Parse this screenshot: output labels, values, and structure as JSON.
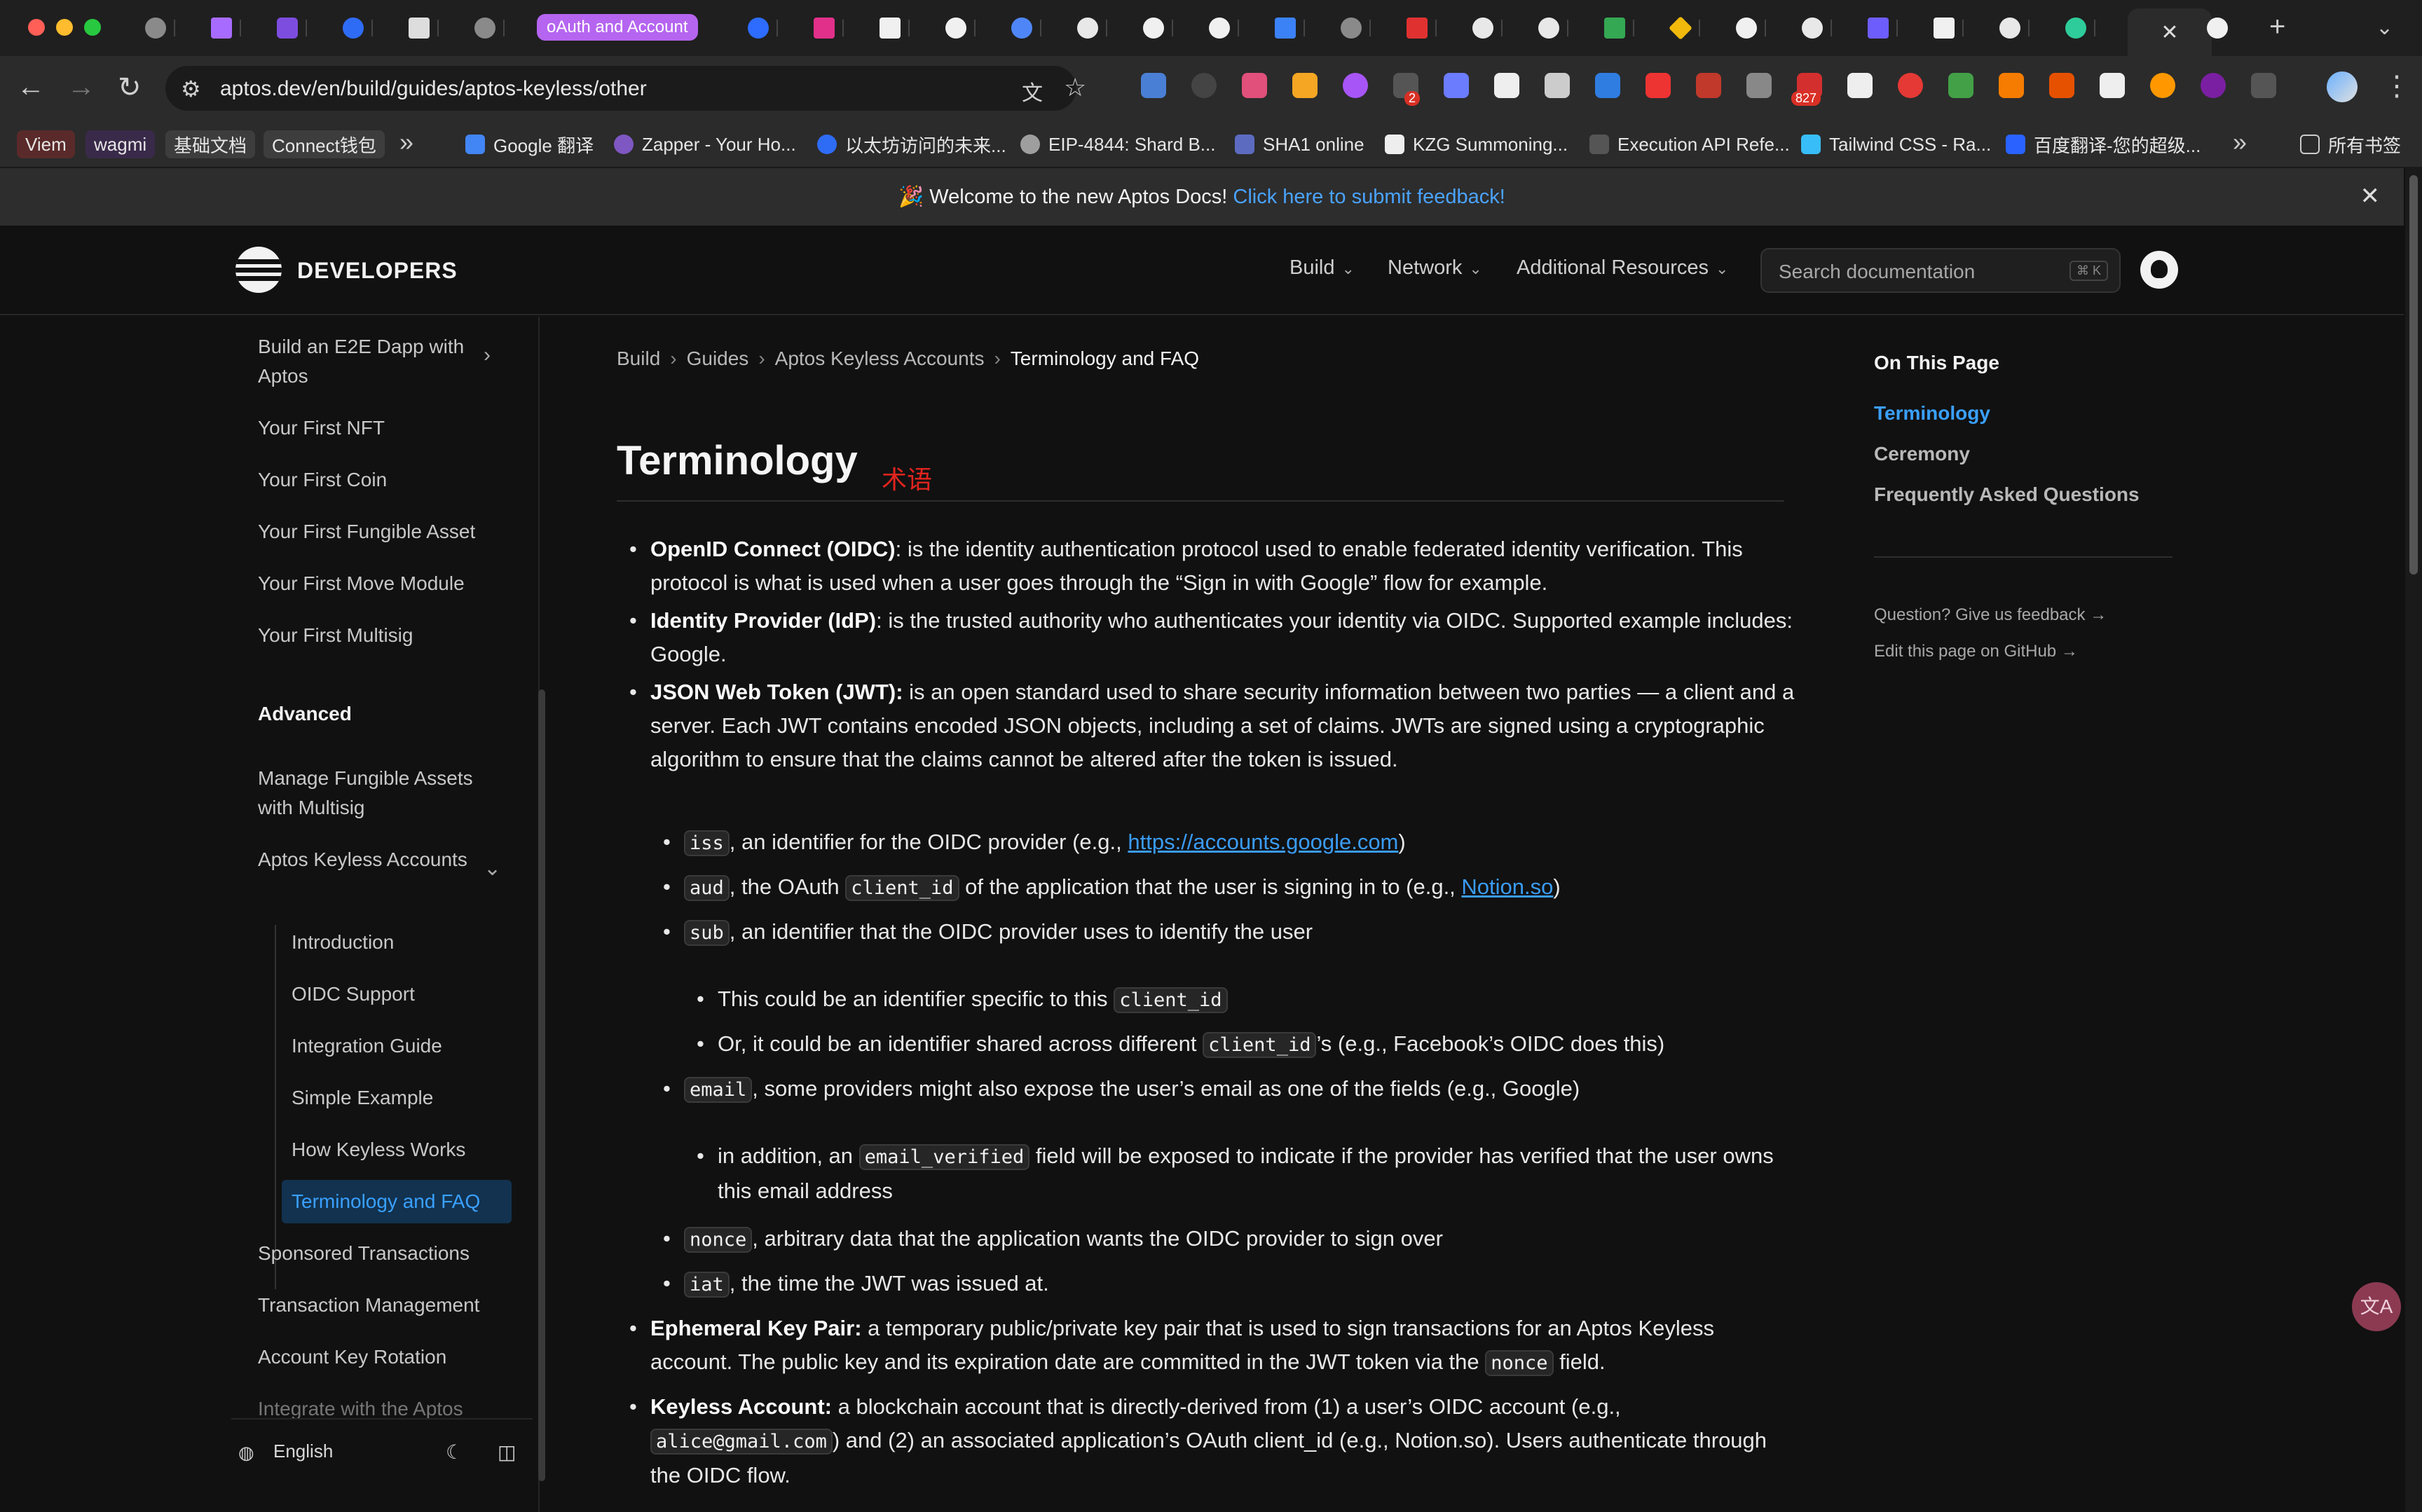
{
  "browser": {
    "active_tab_label": "oAuth and Account",
    "address": "aptos.dev/en/build/guides/aptos-keyless/other",
    "extension_badge": "2",
    "extension_count": "827",
    "bookmarks": [
      {
        "label": "Viem"
      },
      {
        "label": "wagmi"
      },
      {
        "label": "基础文档"
      },
      {
        "label": "Connect钱包"
      },
      {
        "label": "Google 翻译"
      },
      {
        "label": "Zapper - Your Ho..."
      },
      {
        "label": "以太坊访问的未来..."
      },
      {
        "label": "EIP-4844: Shard B..."
      },
      {
        "label": "SHA1 online"
      },
      {
        "label": "KZG Summoning..."
      },
      {
        "label": "Execution API Refe..."
      },
      {
        "label": "Tailwind CSS - Ra..."
      },
      {
        "label": "百度翻译-您的超级..."
      },
      {
        "label": "所有书签"
      }
    ]
  },
  "banner": {
    "text": "🎉 Welcome to the new Aptos Docs!",
    "link": "Click here to submit feedback!"
  },
  "header": {
    "brand": "DEVELOPERS",
    "nav": [
      "Build",
      "Network",
      "Additional Resources"
    ],
    "search_placeholder": "Search documentation",
    "search_shortcut": "⌘ K"
  },
  "sidebar": {
    "items": [
      "Build an E2E Dapp with Aptos",
      "Your First NFT",
      "Your First Coin",
      "Your First Fungible Asset",
      "Your First Move Module",
      "Your First Multisig",
      "Advanced",
      "Manage Fungible Assets with Multisig",
      "Aptos Keyless Accounts",
      "Introduction",
      "OIDC Support",
      "Integration Guide",
      "Simple Example",
      "How Keyless Works",
      "Terminology and FAQ",
      "Sponsored Transactions",
      "Transaction Management",
      "Account Key Rotation",
      "Integrate with the Aptos"
    ],
    "language": "English"
  },
  "breadcrumb": [
    "Build",
    "Guides",
    "Aptos Keyless Accounts",
    "Terminology and FAQ"
  ],
  "page": {
    "title": "Terminology",
    "annotation": "术语"
  },
  "terms": {
    "oidc_term": "OpenID Connect (OIDC)",
    "oidc_desc": ": is the identity authentication protocol used to enable federated identity verification. This protocol is what is used when a user goes through the “Sign in with Google” flow for example.",
    "idp_term": "Identity Provider (IdP)",
    "idp_desc": ": is the trusted authority who authenticates your identity via OIDC. Supported example includes: Google.",
    "jwt_term": "JSON Web Token (JWT):",
    "jwt_desc": " is an open standard used to share security information between two parties — a client and a server. Each JWT contains encoded JSON objects, including a set of claims. JWTs are signed using a cryptographic algorithm to ensure that the claims cannot be altered after the token is issued.",
    "iss_code": "iss",
    "iss_text": ", an identifier for the OIDC provider (e.g., ",
    "iss_link": "https://accounts.google.com",
    "iss_end": ")",
    "aud_code": "aud",
    "aud_text1": ", the OAuth ",
    "aud_code2": "client_id",
    "aud_text2": " of the application that the user is signing in to (e.g., ",
    "aud_link": "Notion.so",
    "aud_end": ")",
    "sub_code": "sub",
    "sub_text": ", an identifier that the OIDC provider uses to identify the user",
    "sub1_text": "This could be an identifier specific to this ",
    "sub1_code": "client_id",
    "sub2_text": "Or, it could be an identifier shared across different ",
    "sub2_code": "client_id",
    "sub2_end": "’s (e.g., Facebook’s OIDC does this)",
    "email_code": "email",
    "email_text": ", some providers might also expose the user’s email as one of the fields (e.g., Google)",
    "ev_text1": "in addition, an ",
    "ev_code": "email_verified",
    "ev_text2": " field will be exposed to indicate if the provider has verified that the user owns this email address",
    "nonce_code": "nonce",
    "nonce_text": ", arbitrary data that the application wants the OIDC provider to sign over",
    "iat_code": "iat",
    "iat_text": ", the time the JWT was issued at.",
    "ekp_term": "Ephemeral Key Pair:",
    "ekp_text1": " a temporary public/private key pair that is used to sign transactions for an Aptos Keyless account. The public key and its expiration date are committed in the JWT token via the ",
    "ekp_code": "nonce",
    "ekp_text2": " field.",
    "ka_term": "Keyless Account:",
    "ka_text1": " a blockchain account that is directly-derived from (1) a user’s OIDC account (e.g., ",
    "ka_code": "alice@gmail.com",
    "ka_text2": ") and (2) an associated application’s OAuth client_id (e.g., Notion.so). Users authenticate through the OIDC flow."
  },
  "toc": {
    "title": "On This Page",
    "items": [
      "Terminology",
      "Ceremony",
      "Frequently Asked Questions"
    ],
    "feedback": "Question? Give us feedback →",
    "edit": "Edit this page on GitHub →"
  },
  "colors": {
    "accent": "#3aa0ff",
    "background": "#111111",
    "annotation": "#e0241e"
  }
}
